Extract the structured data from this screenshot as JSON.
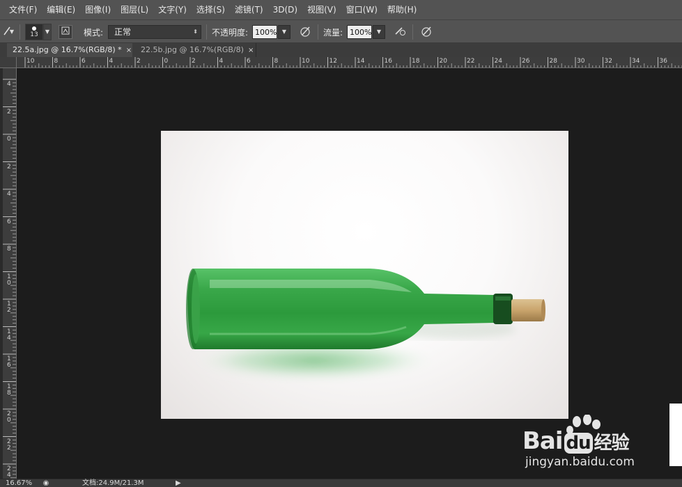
{
  "menubar": {
    "items": [
      "文件(F)",
      "编辑(E)",
      "图像(I)",
      "图层(L)",
      "文字(Y)",
      "选择(S)",
      "滤镜(T)",
      "3D(D)",
      "视图(V)",
      "窗口(W)",
      "帮助(H)"
    ]
  },
  "options": {
    "tool_icon": "brush-icon",
    "brush_size": "13",
    "mode_label": "模式:",
    "mode_value": "正常",
    "opacity_label": "不透明度:",
    "opacity_value": "100%",
    "flow_label": "流量:",
    "flow_value": "100%"
  },
  "tabs": [
    {
      "label": "22.5a.jpg @ 16.7%(RGB/8) *",
      "close": "×"
    },
    {
      "label": "22.5b.jpg @ 16.7%(RGB/8)",
      "close": "×"
    }
  ],
  "ruler_top": [
    "10",
    "8",
    "6",
    "4",
    "2",
    "0",
    "2",
    "4",
    "6",
    "8",
    "10",
    "12",
    "14",
    "16",
    "18",
    "20",
    "22",
    "24",
    "26",
    "28",
    "30",
    "32",
    "34",
    "36"
  ],
  "ruler_left": [
    "4",
    "2",
    "0",
    "2",
    "4",
    "6",
    "8",
    "10",
    "12",
    "14",
    "16",
    "18",
    "20",
    "22",
    "24"
  ],
  "status": {
    "zoom": "16.67%",
    "doc_info": "文档:24.9M/21.3M"
  },
  "watermark": {
    "brand_latin": "Bai",
    "brand_tail": "du",
    "brand_cn": "经验",
    "url": "jingyan.baidu.com"
  },
  "colors": {
    "bottle_green": "#2fa03f",
    "cork": "#c9a46c",
    "watermark_paw": "#e4e4e4"
  }
}
